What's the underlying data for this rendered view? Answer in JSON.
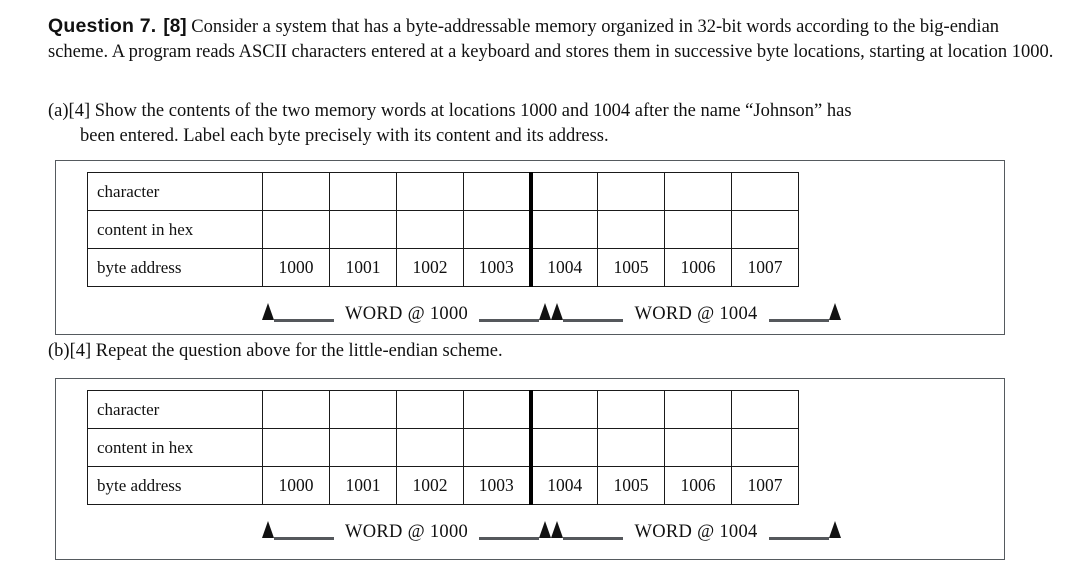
{
  "question": {
    "label": "Question 7.",
    "marks": "[8]",
    "body": "Consider a system that has a byte-addressable memory organized in 32-bit words according to the big-endian scheme. A program reads ASCII characters entered at a keyboard and stores them in successive byte locations, starting at location 1000."
  },
  "parts": [
    {
      "id": "a",
      "prefix": "(a)[4]",
      "text": "Show the contents of the two memory words at locations 1000 and 1004 after the name “Johnson” has",
      "text_cont": "been entered. Label each byte precisely with its content and its address."
    },
    {
      "id": "b",
      "prefix": "(b)[4]",
      "text": "Repeat the question above for the little-endian scheme.",
      "text_cont": ""
    }
  ],
  "table": {
    "row_labels": {
      "character": "character",
      "content_in_hex": "content in hex",
      "byte_address": "byte address"
    },
    "byte_addresses": [
      "1000",
      "1001",
      "1002",
      "1003",
      "1004",
      "1005",
      "1006",
      "1007"
    ],
    "character_values": [
      "",
      "",
      "",
      "",
      "",
      "",
      "",
      ""
    ],
    "hex_values": [
      "",
      "",
      "",
      "",
      "",
      "",
      "",
      ""
    ],
    "word_break_after_index": 3
  },
  "annotations": {
    "word_1000": "WORD @ 1000",
    "word_1004": "WORD @ 1004"
  },
  "colors": {
    "page_background": "#ffffff",
    "text": "#111111",
    "table_border": "#1a1a1a",
    "word_divider": "#000000",
    "panel_border": "#555a5e",
    "rule": "#55585c"
  }
}
